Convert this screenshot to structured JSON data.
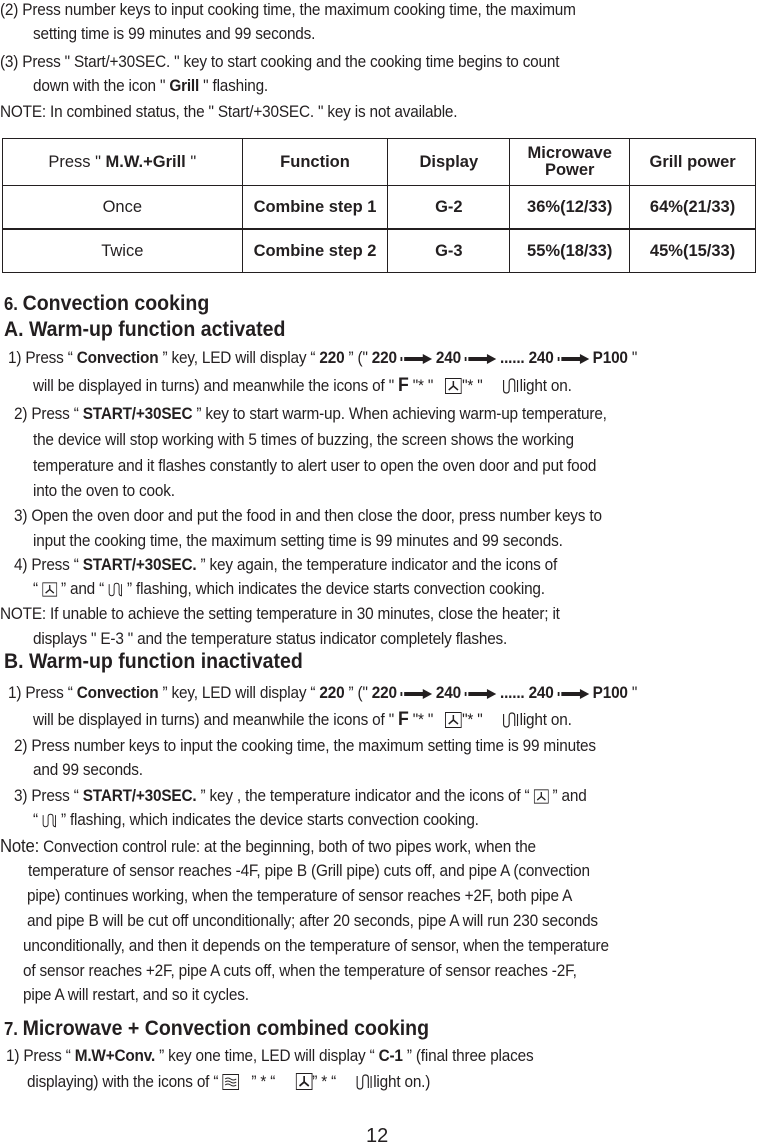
{
  "intro": {
    "step2_l1": "(2) Press number keys to input cooking time, the maximum cooking time, the maximum",
    "step2_l2": "setting time is 99 minutes and 99 seconds.",
    "step3_l1": "(3) Press \" Start/+30SEC. \" key to start cooking and the cooking time begins to count",
    "step3_l2_a": "down with the icon \" ",
    "step3_l2_b": "Grill",
    "step3_l2_c": " \" flashing.",
    "note": "NOTE: In combined status, the \" Start/+30SEC. \" key is not available."
  },
  "table": {
    "header": {
      "press_a": "Press \" ",
      "press_b": "M.W.+Grill",
      "press_c": " \"",
      "function": "Function",
      "display": "Display",
      "mw_power_l1": "Microwave",
      "mw_power_l2": "Power",
      "grill_power": "Grill power"
    },
    "rows": [
      {
        "press": "Once",
        "function": "Combine step 1",
        "display": "G-2",
        "mw_power": "36%(12/33)",
        "grill_power": "64%(21/33)"
      },
      {
        "press": "Twice",
        "function": "Combine step 2",
        "display": "G-3",
        "mw_power": "55%(18/33)",
        "grill_power": "45%(15/33)"
      }
    ]
  },
  "sec6": {
    "num": "6. ",
    "title": "Convection cooking",
    "A": {
      "title": "A. Warm-up function activated",
      "s1_a": "1) Press “ ",
      "s1_key": "Convection",
      "s1_b": " ” key, LED will display “ ",
      "s1_val": "220",
      "s1_c": " ” (\" ",
      "seq": [
        "220",
        "240",
        "...... 240",
        "P100"
      ],
      "s1_d": " \"",
      "s1_l2_a": "will be displayed in turns) and meanwhile the icons of \"  ",
      "s1_l2_F": "F",
      "s1_l2_b": " \"* \"",
      "s1_l2_c": "\"* \"",
      "s1_l2_d": "light on.",
      "s2_a": "2) Press “ ",
      "s2_key": "START/+30SEC",
      "s2_b": " ” key to start warm-up. When achieving warm-up temperature,",
      "s2_l2": "the device will stop working with 5 times of buzzing, the screen shows the working",
      "s2_l3": "temperature and it flashes constantly to alert user to open the oven door and put food",
      "s2_l4": "into the oven to cook.",
      "s3_l1": "3) Open the oven door and put the food in and then close the door, press number keys to",
      "s3_l2": "input the cooking time, the maximum setting time is 99 minutes and 99 seconds.",
      "s4_a": "4) Press “ ",
      "s4_key": "START/+30SEC.",
      "s4_b": " ” key again, the temperature indicator and the icons of",
      "s4_l2_a": "“ ",
      "s4_l2_b": " ” and “ ",
      "s4_l2_c": " ” flashing, which indicates the device starts convection cooking.",
      "note_l1": "NOTE: If unable to achieve the setting temperature in 30 minutes, close the heater; it",
      "note_l2": "displays \" E-3 \" and the temperature status indicator completely flashes."
    },
    "B": {
      "title": "B. Warm-up function inactivated",
      "s2_l1": "2) Press number keys to input the cooking time, the maximum setting time is 99 minutes",
      "s2_l2": "and 99 seconds.",
      "s3_a": "3) Press “ ",
      "s3_key": "START/+30SEC.",
      "s3_b": " ” key , the temperature indicator and the icons of “ ",
      "s3_c": " ” and",
      "s3_l2_a": "“ ",
      "s3_l2_b": " ” flashing, which indicates the device starts convection cooking.",
      "note_label": "Note:",
      "note_l1": " Convection control rule: at the beginning, both of two pipes work, when the",
      "note_l2": "temperature of sensor reaches -4F, pipe B (Grill pipe) cuts off, and pipe A (convection",
      "note_l3": "pipe) continues working, when the temperature of sensor reaches +2F, both pipe A",
      "note_l4": "and pipe B will be cut off unconditionally; after 20 seconds, pipe A will run 230 seconds",
      "note_l5": "unconditionally, and then it depends on the temperature of sensor, when the temperature",
      "note_l6": "of sensor reaches +2F, pipe A cuts off, when the temperature of sensor reaches -2F,",
      "note_l7": "pipe A will restart, and so it cycles."
    }
  },
  "sec7": {
    "num": "7. ",
    "title": "Microwave + Convection combined cooking",
    "s1_a": "1) Press “ ",
    "s1_key": "M.W+Conv.",
    "s1_b": " ” key one time, LED will display “ ",
    "s1_val": "C-1",
    "s1_c": " ” (final three places",
    "s1_l2_a": "displaying) with the icons of “ ",
    "s1_l2_b": " ” * “ ",
    "s1_l2_c": "” *  “",
    "s1_l2_d": "light on.)"
  },
  "icons": {
    "fan": "convection-fan-icon",
    "heater": "heater-element-icon",
    "microwave": "microwave-waves-icon",
    "arrow": "right-arrow-icon"
  },
  "page_number": "12"
}
